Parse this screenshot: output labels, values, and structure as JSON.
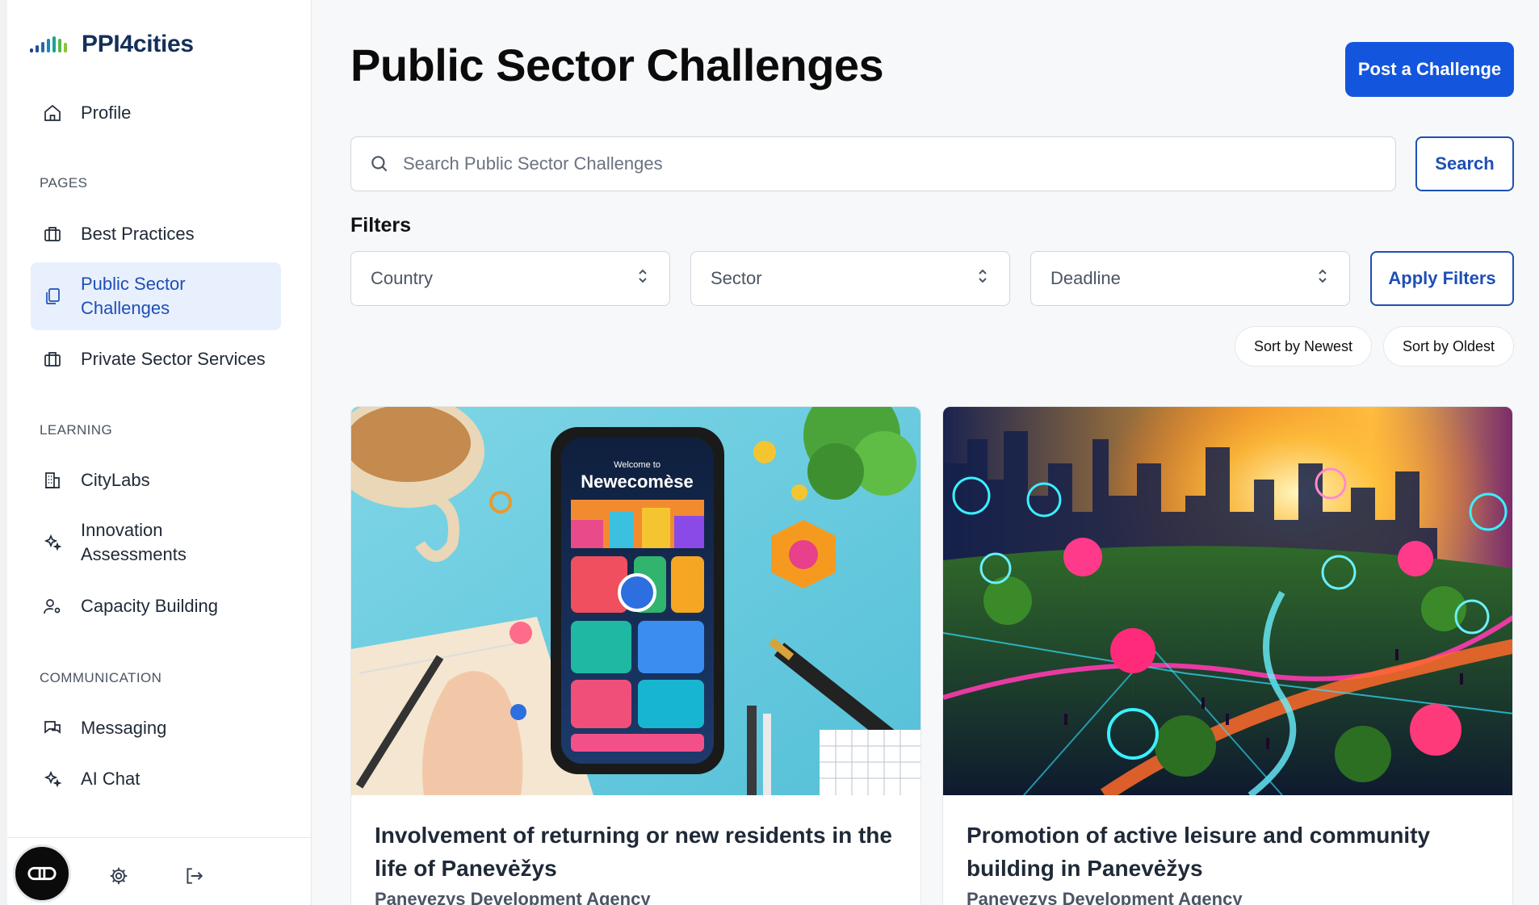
{
  "app": {
    "name": "PPI4cities"
  },
  "sidebar": {
    "profile": {
      "label": "Profile",
      "icon": "home-icon"
    },
    "sections": {
      "pages": "PAGES",
      "learning": "LEARNING",
      "communication": "COMMUNICATION"
    },
    "items": [
      {
        "label": "Best Practices",
        "icon": "briefcase-icon"
      },
      {
        "label": "Public Sector Challenges",
        "line1": "Public Sector",
        "line2": "Challenges",
        "icon": "copy-icon",
        "active": true
      },
      {
        "label": "Private Sector Services",
        "icon": "briefcase-icon"
      },
      {
        "label": "CityLabs",
        "icon": "building-icon"
      },
      {
        "label": "Innovation Assessments",
        "line1": "Innovation",
        "line2": "Assessments",
        "icon": "sparkles-icon"
      },
      {
        "label": "Capacity Building",
        "icon": "user-cog-icon"
      },
      {
        "label": "Messaging",
        "icon": "chat-icon"
      },
      {
        "label": "AI Chat",
        "icon": "sparkles-icon"
      }
    ],
    "footer": {
      "help_icon": "infinity-icon",
      "settings_icon": "gear-icon",
      "logout_icon": "logout-icon"
    }
  },
  "main": {
    "title": "Public Sector Challenges",
    "post_button": "Post a Challenge",
    "search": {
      "placeholder": "Search Public Sector Challenges",
      "value": "",
      "button": "Search"
    },
    "filters": {
      "heading": "Filters",
      "country": "Country",
      "sector": "Sector",
      "deadline": "Deadline",
      "apply": "Apply Filters"
    },
    "sort": {
      "newest": "Sort by Newest",
      "oldest": "Sort by Oldest"
    },
    "cards": [
      {
        "title": "Involvement of returning or new residents in the life of Panevėžys",
        "org": "Panevezys Development Agency",
        "image_alt": "phone app illustration",
        "phone_text_small": "Welcome to",
        "phone_text_big": "Newecomèse"
      },
      {
        "title": "Promotion of active leisure and community building in Panevėžys",
        "org": "Panevezys Development Agency",
        "image_alt": "neon city park illustration"
      }
    ]
  },
  "colors": {
    "accent": "#1356dd",
    "active_bg": "#e8f0fd",
    "active_text": "#1e4fb5"
  }
}
